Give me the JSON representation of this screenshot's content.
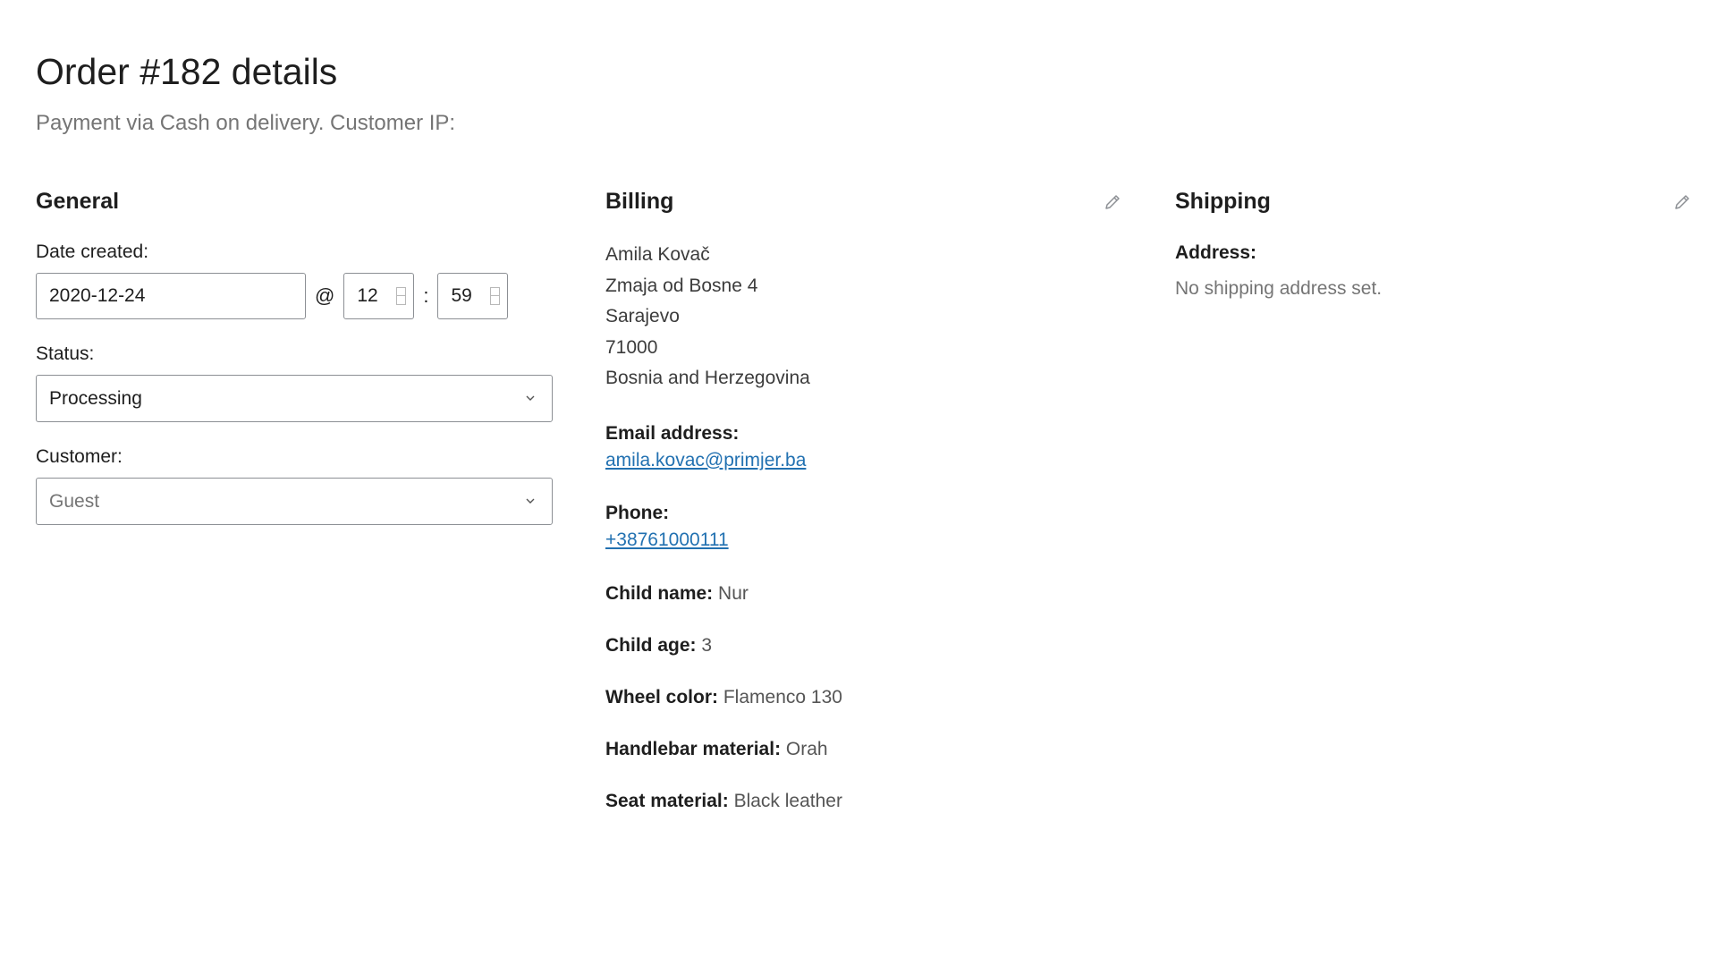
{
  "header": {
    "title": "Order #182 details",
    "subtitle": "Payment via Cash on delivery. Customer IP:"
  },
  "general": {
    "heading": "General",
    "date_label": "Date created:",
    "date_value": "2020-12-24",
    "at_sep": "@",
    "hour_value": "12",
    "colon_sep": ":",
    "minute_value": "59",
    "status_label": "Status:",
    "status_value": "Processing",
    "customer_label": "Customer:",
    "customer_value": "Guest"
  },
  "billing": {
    "heading": "Billing",
    "address_lines": [
      "Amila Kovač",
      "Zmaja od Bosne 4",
      "Sarajevo",
      "71000",
      "Bosnia and Herzegovina"
    ],
    "email_label": "Email address:",
    "email_value": "amila.kovac@primjer.ba",
    "phone_label": "Phone:",
    "phone_value": "+38761000111",
    "meta": [
      {
        "key": "Child name:",
        "value": "Nur"
      },
      {
        "key": "Child age:",
        "value": "3"
      },
      {
        "key": "Wheel color:",
        "value": "Flamenco 130"
      },
      {
        "key": "Handlebar material:",
        "value": "Orah"
      },
      {
        "key": "Seat material:",
        "value": "Black leather"
      }
    ]
  },
  "shipping": {
    "heading": "Shipping",
    "address_label": "Address:",
    "address_value": "No shipping address set."
  },
  "icons": {
    "edit": "pencil-icon",
    "dropdown": "chevron-down-icon"
  },
  "colors": {
    "link": "#2271b1",
    "muted_text": "#757575",
    "border": "#8c8f94"
  }
}
